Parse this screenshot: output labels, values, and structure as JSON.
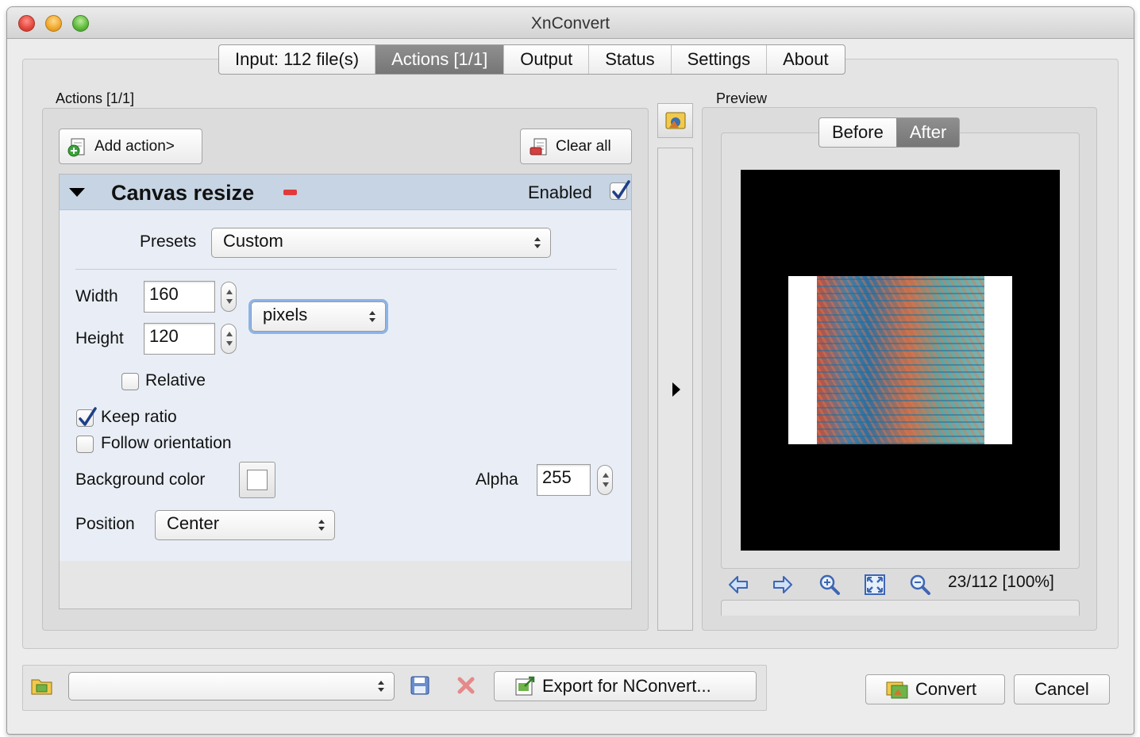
{
  "window": {
    "title": "XnConvert"
  },
  "tabs": [
    {
      "label": "Input: 112 file(s)",
      "active": false
    },
    {
      "label": "Actions [1/1]",
      "active": true
    },
    {
      "label": "Output",
      "active": false
    },
    {
      "label": "Status",
      "active": false
    },
    {
      "label": "Settings",
      "active": false
    },
    {
      "label": "About",
      "active": false
    }
  ],
  "actions": {
    "group_label": "Actions [1/1]",
    "add_action_label": "Add action>",
    "clear_all_label": "Clear all",
    "action": {
      "title": "Canvas resize",
      "enabled_label": "Enabled",
      "enabled": true,
      "presets_label": "Presets",
      "presets_value": "Custom",
      "width_label": "Width",
      "width_value": "160",
      "height_label": "Height",
      "height_value": "120",
      "unit_value": "pixels",
      "relative_label": "Relative",
      "relative_checked": false,
      "keep_ratio_label": "Keep ratio",
      "keep_ratio_checked": true,
      "follow_orientation_label": "Follow orientation",
      "follow_orientation_checked": false,
      "background_color_label": "Background color",
      "background_color": "#ffffff",
      "alpha_label": "Alpha",
      "alpha_value": "255",
      "position_label": "Position",
      "position_value": "Center"
    }
  },
  "preview": {
    "group_label": "Preview",
    "before_label": "Before",
    "after_label": "After",
    "active_view": "After",
    "counter": "23/112 [100%]",
    "nav_icons": [
      "arrow-left-icon",
      "arrow-right-icon",
      "zoom-in-icon",
      "fit-to-window-icon",
      "zoom-out-icon"
    ]
  },
  "bottom": {
    "preset_select_value": "",
    "export_label": "Export for NConvert...",
    "convert_label": "Convert",
    "cancel_label": "Cancel"
  },
  "colors": {
    "active_tab": "#7f7f7f",
    "action_header": "#c6d4e3",
    "action_body": "#e9eef6",
    "remove_icon": "#e03a3a"
  }
}
